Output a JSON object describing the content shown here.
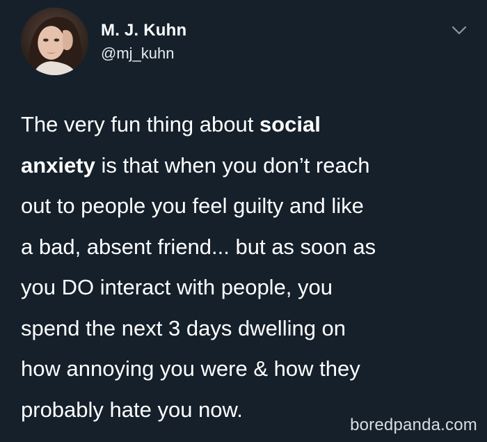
{
  "tweet": {
    "author": {
      "display_name": "M. J. Kuhn",
      "handle": "@mj_kuhn",
      "avatar_icon": "profile-photo"
    },
    "menu_icon": "chevron-down-icon",
    "lines": [
      {
        "pre": "The very fun thing about ",
        "bold": "social",
        "post": ""
      },
      {
        "pre": "",
        "bold": "anxiety",
        "post": " is that when you don’t reach"
      },
      {
        "pre": "out to people you feel guilty and like",
        "bold": "",
        "post": ""
      },
      {
        "pre": "a bad, absent friend... but as soon as",
        "bold": "",
        "post": ""
      },
      {
        "pre": "you DO interact with people, you",
        "bold": "",
        "post": ""
      },
      {
        "pre": "spend the next 3 days dwelling on",
        "bold": "",
        "post": ""
      },
      {
        "pre": "how annoying you were & how they",
        "bold": "",
        "post": ""
      },
      {
        "pre": "probably hate you now.",
        "bold": "",
        "post": ""
      }
    ]
  },
  "watermark": "boredpanda.com",
  "colors": {
    "background": "#15202b",
    "text": "#ffffff",
    "secondary_text": "#e6ecf0",
    "caret": "#8899a6"
  }
}
